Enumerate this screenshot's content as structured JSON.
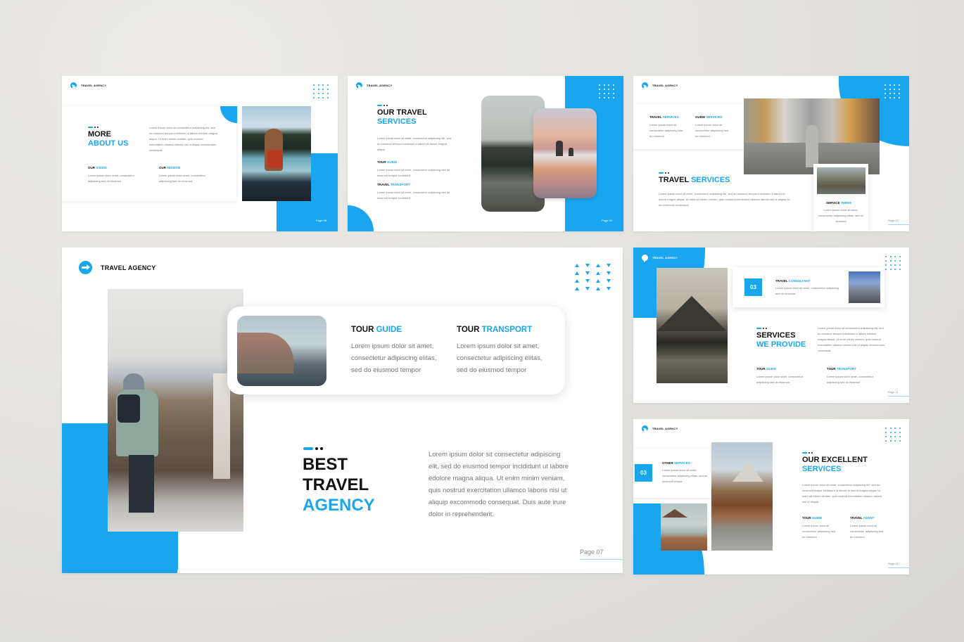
{
  "brand": {
    "name": "TRAVEL AGENCY",
    "accent_color": "#1aa6ef",
    "text_color": "#111111"
  },
  "slides": {
    "s08": {
      "title_line1": "MORE",
      "title_line2": "ABOUT US",
      "paragraph": "Lorem ipsum dolor sit consectetur adipiscing elit, sed do eiusmod tempor incididunt ut labore edolore magna aliqua. Ut enim minim veniam, quis nostrud exercitation ullamco laboris nisi ut aliquip excommodo consequat.",
      "vision_label_a": "OUR",
      "vision_label_b": "VISION",
      "vision_text": "Lorem ipsum dolor amet, consectetur adipiscing sed do eiusmod",
      "mission_label_a": "OUR",
      "mission_label_b": "MISSION",
      "mission_text": "Lorem ipsum dolor amet, consectetur adipiscing sed do eiusmod",
      "page": "Page 08",
      "photo": "woman-in-canoe-photo"
    },
    "s09": {
      "title_line1": "OUR TRAVEL",
      "title_line2": "SERVICES",
      "paragraph": "Lorem ipsum dolor sit amet, consectetur adipiscing elit, sed do eiusmod tempor incididunt ut labore et dolore magna aliqua.",
      "item1_a": "TOUR",
      "item1_b": "GUIDE",
      "item1_text": "Lorem ipsum dolor sit amet, consectetur adipiscing sed do eiusmod tempor incididunt",
      "item2_a": "TRAVEL",
      "item2_b": "TRANSPORT",
      "item2_text": "Lorem ipsum dolor sit amet, consectetur adipiscing sed do eiusmod tempor incididunt",
      "page": "Page 09"
    },
    "s10": {
      "item1_a": "TRAVEL",
      "item1_b": "SERVICES",
      "item1_text": "Lorem ipsum dolor sit consectetur adipiscing sed do eiusmod",
      "item2_a": "GUIDE",
      "item2_b": "SERVICES",
      "item2_text": "Lorem ipsum dolor sit consectetur adipiscing sed do eiusmod",
      "title_a": "TRAVEL",
      "title_b": "SERVICES",
      "paragraph": "Lorem ipsum dolor sit amet, consectetur adipiscing elit, sed do eiusmod tempor incididunt ut labore et dolore magna aliqua. Ut enim ad minim veniam, quis nostrud exercitation ullamco laboris nisi ut aliquip ex ea commodo consequat.",
      "card_a": "SERVICE",
      "card_b": "THREE",
      "card_text": "Lorem ipsum dolor sit amet, consectetur adipiscing elitas, sed do eiusmod",
      "page": "Page 10"
    },
    "s07": {
      "guide_a": "TOUR",
      "guide_b": "GUIDE",
      "guide_text": "Lorem ipsum dolor sit amet, consectetur adipiscing elitas, sed do eiusmod tempor",
      "transport_a": "TOUR",
      "transport_b": "TRANSPORT",
      "transport_text": "Lorem ipsum dolor sit amet, consectetur adipiscing elitas, sed do eiusmod tempor",
      "title_line1": "BEST",
      "title_line2": "TRAVEL",
      "title_line3": "AGENCY",
      "paragraph": "Lorem ipsum dolor sit consectetur adipiscing elit, sed do eiusmod tempor incididunt ut labore edolore magna aliqua. Ut enim minim veniam, quis nostrud exercitation ullamco laboris nisi ut aliquip excommodo consequat. Duis aute irure dolor in reprehenderit.",
      "page": "Page 07"
    },
    "s11": {
      "num": "03",
      "consult_a": "TRAVEL",
      "consult_b": "CONSULTANT",
      "consult_text": "Lorem ipsum dolor sit amet, consectetur adipiscing sed do eiusmod",
      "title_line1": "SERVICES",
      "title_line2": "WE PROVIDE",
      "paragraph": "Lorem ipsum dolor sit consectetur adipiscing elit, sed do eiusmod tempor incididunt ut labore edolore magna aliqua. Ut enim minim veniam, quis nostrud exercitation ullamco laboris nisi ut aliquip excommodo consequat.",
      "item1_a": "TOUR",
      "item1_b": "GUIDE",
      "item1_text": "Lorem ipsum dolor amet, consectetur adipiscing sed do eiusmod",
      "item2_a": "TOUR",
      "item2_b": "TRANSPORT",
      "item2_text": "Lorem ipsum dolor amet, consectetur adipiscing sed do eiusmod",
      "page": "Page 11"
    },
    "s12": {
      "num": "03",
      "other_a": "OTHER",
      "other_b": "SERVICES",
      "other_text": "Lorem ipsum dolor sit amet, consectetur adipiscing elitas, sed do eiusmod tempor",
      "title_line1": "OUR EXCELLENT",
      "title_line2": "SERVICES",
      "paragraph": "Lorem ipsum dolor sit amet, consectetur adipiscing elit, sed do eiusmod tempor incididunt ut labore et dolore magna aliqua. Ut enim ad minim veniam, quis nostrud exercitation ullamco laboris nisi ut aliquip.",
      "item1_a": "TOUR",
      "item1_b": "GUIDE",
      "item1_text": "Lorem ipsum dolor sit consectetur adipiscing sed do eiusmod",
      "item2_a": "TRAVEL",
      "item2_b": "AGENT",
      "item2_text": "Lorem ipsum dolor sit consectetur adipiscing sed do eiusmod",
      "page": "Page 12"
    }
  }
}
